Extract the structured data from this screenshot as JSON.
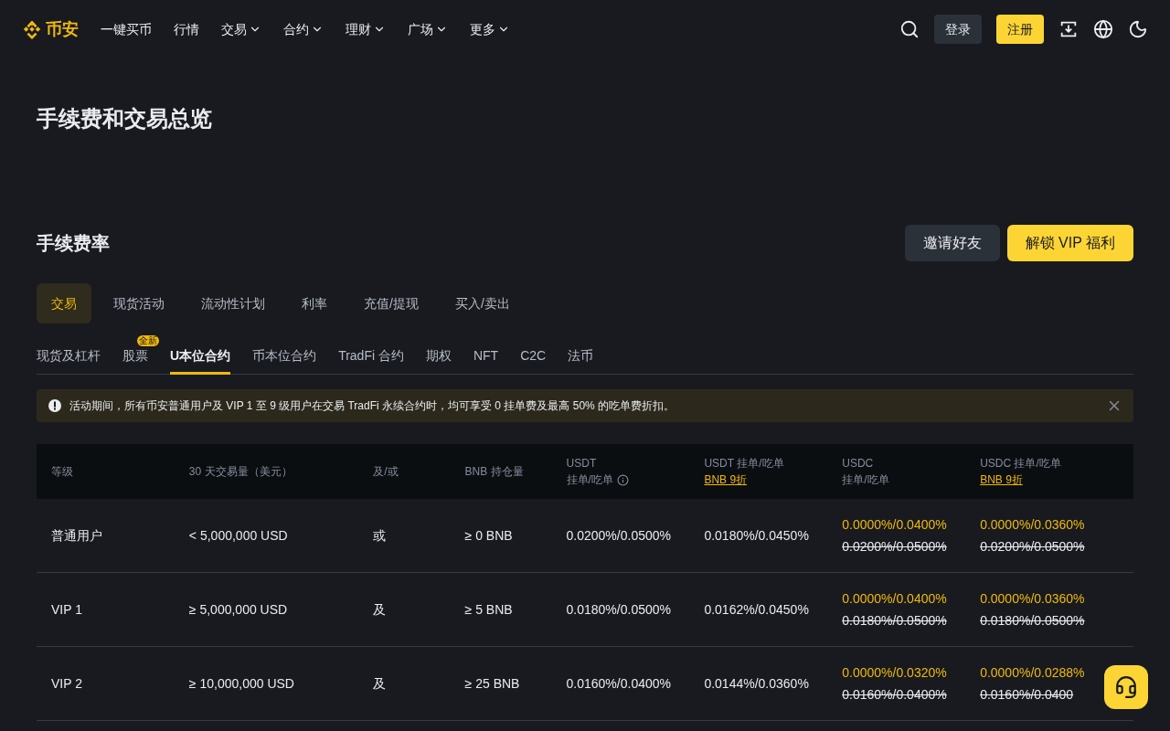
{
  "nav": {
    "logo": "币安",
    "items": [
      {
        "label": "一键买币",
        "dropdown": false
      },
      {
        "label": "行情",
        "dropdown": false
      },
      {
        "label": "交易",
        "dropdown": true
      },
      {
        "label": "合约",
        "dropdown": true
      },
      {
        "label": "理财",
        "dropdown": true
      },
      {
        "label": "广场",
        "dropdown": true
      },
      {
        "label": "更多",
        "dropdown": true
      }
    ],
    "login": "登录",
    "register": "注册"
  },
  "page_title": "手续费和交易总览",
  "section": {
    "title": "手续费率",
    "buttons": [
      {
        "label": "邀请好友",
        "kind": "secondary"
      },
      {
        "label": "解锁 VIP 福利",
        "kind": "primary"
      }
    ]
  },
  "tabs": [
    {
      "label": "交易",
      "selected": true
    },
    {
      "label": "现货活动",
      "selected": false
    },
    {
      "label": "流动性计划",
      "selected": false
    },
    {
      "label": "利率",
      "selected": false
    },
    {
      "label": "充值/提现",
      "selected": false
    },
    {
      "label": "买入/卖出",
      "selected": false
    }
  ],
  "subtabs": [
    {
      "label": "现货及杠杆",
      "selected": false
    },
    {
      "label": "股票",
      "selected": false,
      "badge": "全新"
    },
    {
      "label": "U本位合约",
      "selected": true
    },
    {
      "label": "币本位合约",
      "selected": false
    },
    {
      "label": "TradFi 合约",
      "selected": false
    },
    {
      "label": "期权",
      "selected": false
    },
    {
      "label": "NFT",
      "selected": false
    },
    {
      "label": "C2C",
      "selected": false
    },
    {
      "label": "法币",
      "selected": false
    }
  ],
  "alert": "活动期间，所有币安普通用户及 VIP 1 至 9 级用户在交易 TradFi 永续合约时，均可享受 0 挂单费及最高 50% 的吃单费折扣。",
  "table": {
    "columns": [
      {
        "label": "等级"
      },
      {
        "label": "30 天交易量（美元）"
      },
      {
        "label": "及/或"
      },
      {
        "label": "BNB 持仓量"
      },
      {
        "label": "USDT",
        "sub": "挂单/吃单",
        "info": true
      },
      {
        "label": "USDT 挂单/吃单",
        "link": "BNB 9折"
      },
      {
        "label": "USDC",
        "sub": "挂单/吃单"
      },
      {
        "label": "USDC 挂单/吃单",
        "link": "BNB 9折"
      }
    ],
    "rows": [
      {
        "cells": [
          {
            "kind": "text",
            "text": "普通用户"
          },
          {
            "kind": "text",
            "text": "< 5,000,000 USD"
          },
          {
            "kind": "text",
            "text": "或"
          },
          {
            "kind": "text",
            "text": "≥ 0 BNB"
          },
          {
            "kind": "text",
            "text": "0.0200%/0.0500%"
          },
          {
            "kind": "text",
            "text": "0.0180%/0.0450%"
          },
          {
            "kind": "discount",
            "new": "0.0000%/0.0400%",
            "old": "0.0200%/0.0500%"
          },
          {
            "kind": "discount",
            "new": "0.0000%/0.0360%",
            "old": "0.0200%/0.0500%"
          }
        ]
      },
      {
        "cells": [
          {
            "kind": "text",
            "text": "VIP 1"
          },
          {
            "kind": "text",
            "text": "≥ 5,000,000 USD"
          },
          {
            "kind": "text",
            "text": "及"
          },
          {
            "kind": "text",
            "text": "≥ 5 BNB"
          },
          {
            "kind": "text",
            "text": "0.0180%/0.0500%"
          },
          {
            "kind": "text",
            "text": "0.0162%/0.0450%"
          },
          {
            "kind": "discount",
            "new": "0.0000%/0.0400%",
            "old": "0.0180%/0.0500%"
          },
          {
            "kind": "discount",
            "new": "0.0000%/0.0360%",
            "old": "0.0180%/0.0500%"
          }
        ]
      },
      {
        "cells": [
          {
            "kind": "text",
            "text": "VIP 2"
          },
          {
            "kind": "text",
            "text": "≥ 10,000,000 USD"
          },
          {
            "kind": "text",
            "text": "及"
          },
          {
            "kind": "text",
            "text": "≥ 25 BNB"
          },
          {
            "kind": "text",
            "text": "0.0160%/0.0400%"
          },
          {
            "kind": "text",
            "text": "0.0144%/0.0360%"
          },
          {
            "kind": "discount",
            "new": "0.0000%/0.0320%",
            "old": "0.0160%/0.0400%"
          },
          {
            "kind": "discount",
            "new": "0.0000%/0.0288%",
            "old": "0.0160%/0.0400"
          }
        ]
      }
    ]
  }
}
